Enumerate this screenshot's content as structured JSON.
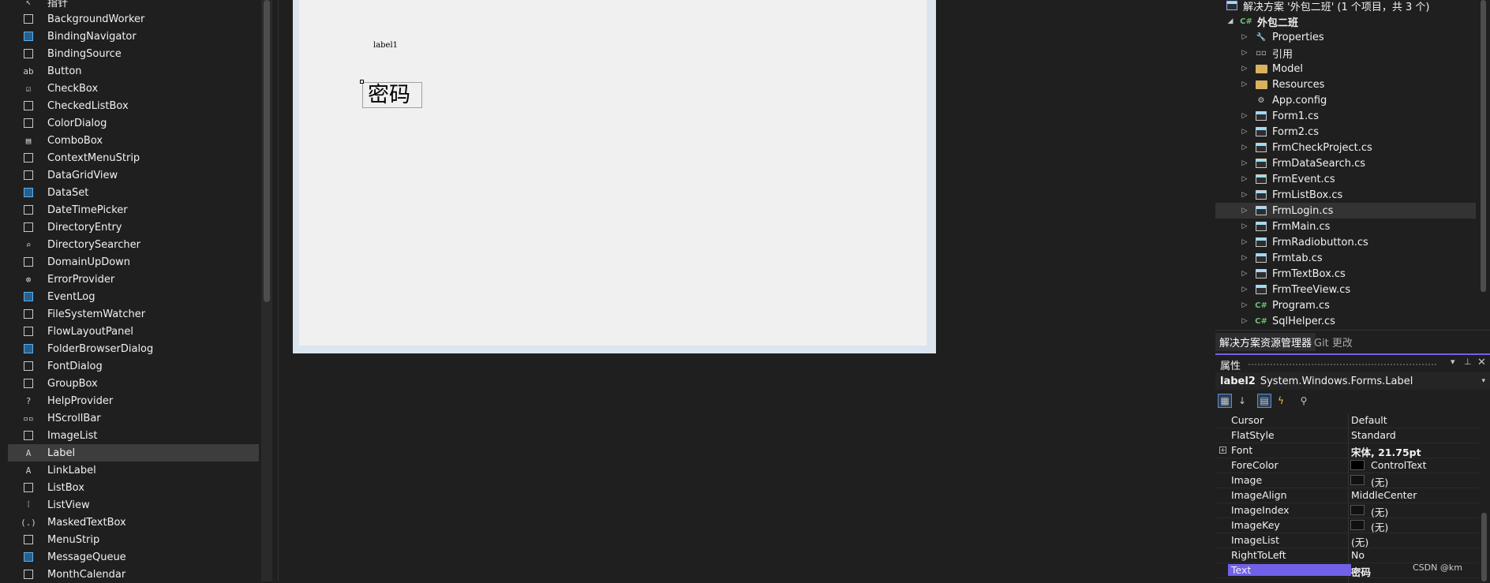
{
  "toolbox": {
    "top_partial_item": "指针",
    "items": [
      {
        "label": "BackgroundWorker",
        "icon": "background-worker-icon"
      },
      {
        "label": "BindingNavigator",
        "icon": "binding-navigator-icon"
      },
      {
        "label": "BindingSource",
        "icon": "binding-source-icon"
      },
      {
        "label": "Button",
        "icon": "button-icon"
      },
      {
        "label": "CheckBox",
        "icon": "checkbox-icon"
      },
      {
        "label": "CheckedListBox",
        "icon": "checked-listbox-icon"
      },
      {
        "label": "ColorDialog",
        "icon": "color-dialog-icon"
      },
      {
        "label": "ComboBox",
        "icon": "combobox-icon"
      },
      {
        "label": "ContextMenuStrip",
        "icon": "context-menu-strip-icon"
      },
      {
        "label": "DataGridView",
        "icon": "datagridview-icon"
      },
      {
        "label": "DataSet",
        "icon": "dataset-icon"
      },
      {
        "label": "DateTimePicker",
        "icon": "datetimepicker-icon"
      },
      {
        "label": "DirectoryEntry",
        "icon": "directory-entry-icon"
      },
      {
        "label": "DirectorySearcher",
        "icon": "directory-searcher-icon"
      },
      {
        "label": "DomainUpDown",
        "icon": "domain-updown-icon"
      },
      {
        "label": "ErrorProvider",
        "icon": "error-provider-icon"
      },
      {
        "label": "EventLog",
        "icon": "eventlog-icon"
      },
      {
        "label": "FileSystemWatcher",
        "icon": "filesystem-watcher-icon"
      },
      {
        "label": "FlowLayoutPanel",
        "icon": "flowlayout-panel-icon"
      },
      {
        "label": "FolderBrowserDialog",
        "icon": "folder-browser-dialog-icon"
      },
      {
        "label": "FontDialog",
        "icon": "font-dialog-icon"
      },
      {
        "label": "GroupBox",
        "icon": "groupbox-icon"
      },
      {
        "label": "HelpProvider",
        "icon": "help-provider-icon"
      },
      {
        "label": "HScrollBar",
        "icon": "hscrollbar-icon"
      },
      {
        "label": "ImageList",
        "icon": "imagelist-icon"
      },
      {
        "label": "Label",
        "icon": "label-icon"
      },
      {
        "label": "LinkLabel",
        "icon": "linklabel-icon"
      },
      {
        "label": "ListBox",
        "icon": "listbox-icon"
      },
      {
        "label": "ListView",
        "icon": "listview-icon"
      },
      {
        "label": "MaskedTextBox",
        "icon": "masked-textbox-icon"
      },
      {
        "label": "MenuStrip",
        "icon": "menustrip-icon"
      },
      {
        "label": "MessageQueue",
        "icon": "message-queue-icon"
      },
      {
        "label": "MonthCalendar",
        "icon": "month-calendar-icon"
      }
    ],
    "selected": "Label"
  },
  "designer": {
    "label1_text": "label1",
    "label2_text": "密码",
    "form_background": "#f0f0f0"
  },
  "solution_explorer": {
    "solution_title": "解决方案 '外包二班' (1 个项目，共 3 个)",
    "project": "外包二班",
    "items": [
      {
        "label": "Properties",
        "icon": "wrench-icon",
        "arrow": true
      },
      {
        "label": "引用",
        "icon": "references-icon",
        "arrow": true
      },
      {
        "label": "Model",
        "icon": "folder-icon",
        "arrow": true
      },
      {
        "label": "Resources",
        "icon": "folder-icon",
        "arrow": true
      },
      {
        "label": "App.config",
        "icon": "config-file-icon",
        "arrow": false
      },
      {
        "label": "Form1.cs",
        "icon": "form-icon",
        "arrow": true
      },
      {
        "label": "Form2.cs",
        "icon": "form-icon",
        "arrow": true
      },
      {
        "label": "FrmCheckProject.cs",
        "icon": "form-icon",
        "arrow": true
      },
      {
        "label": "FrmDataSearch.cs",
        "icon": "form-icon",
        "arrow": true
      },
      {
        "label": "FrmEvent.cs",
        "icon": "form-icon",
        "arrow": true
      },
      {
        "label": "FrmListBox.cs",
        "icon": "form-icon",
        "arrow": true
      },
      {
        "label": "FrmLogin.cs",
        "icon": "form-icon",
        "arrow": true
      },
      {
        "label": "FrmMain.cs",
        "icon": "form-icon",
        "arrow": true
      },
      {
        "label": "FrmRadiobutton.cs",
        "icon": "form-icon",
        "arrow": true
      },
      {
        "label": "Frmtab.cs",
        "icon": "form-icon",
        "arrow": true
      },
      {
        "label": "FrmTextBox.cs",
        "icon": "form-icon",
        "arrow": true
      },
      {
        "label": "FrmTreeView.cs",
        "icon": "form-icon",
        "arrow": true
      },
      {
        "label": "Program.cs",
        "icon": "csharp-file-icon",
        "arrow": true
      },
      {
        "label": "SqlHelper.cs",
        "icon": "csharp-file-icon",
        "arrow": true
      }
    ],
    "selected": "FrmLogin.cs",
    "tabs": [
      "解决方案资源管理器",
      "Git 更改"
    ]
  },
  "properties": {
    "title": "属性",
    "object_name": "label2",
    "object_type": "System.Windows.Forms.Label",
    "accent_color": "#7160e8",
    "rows": [
      {
        "name": "Cursor",
        "value": "Default"
      },
      {
        "name": "FlatStyle",
        "value": "Standard"
      },
      {
        "name": "Font",
        "value": "宋体, 21.75pt",
        "bold": true,
        "expandable": true
      },
      {
        "name": "ForeColor",
        "value": "ControlText",
        "swatch": "#000000"
      },
      {
        "name": "Image",
        "value": "(无)",
        "swatch": "#111111"
      },
      {
        "name": "ImageAlign",
        "value": "MiddleCenter"
      },
      {
        "name": "ImageIndex",
        "value": "(无)",
        "swatch": "#111111"
      },
      {
        "name": "ImageKey",
        "value": "(无)",
        "swatch": "#111111"
      },
      {
        "name": "ImageList",
        "value": "(无)"
      },
      {
        "name": "RightToLeft",
        "value": "No"
      },
      {
        "name": "Text",
        "value": "密码",
        "bold": true,
        "selected": true
      }
    ]
  },
  "watermark": "CSDN @km"
}
